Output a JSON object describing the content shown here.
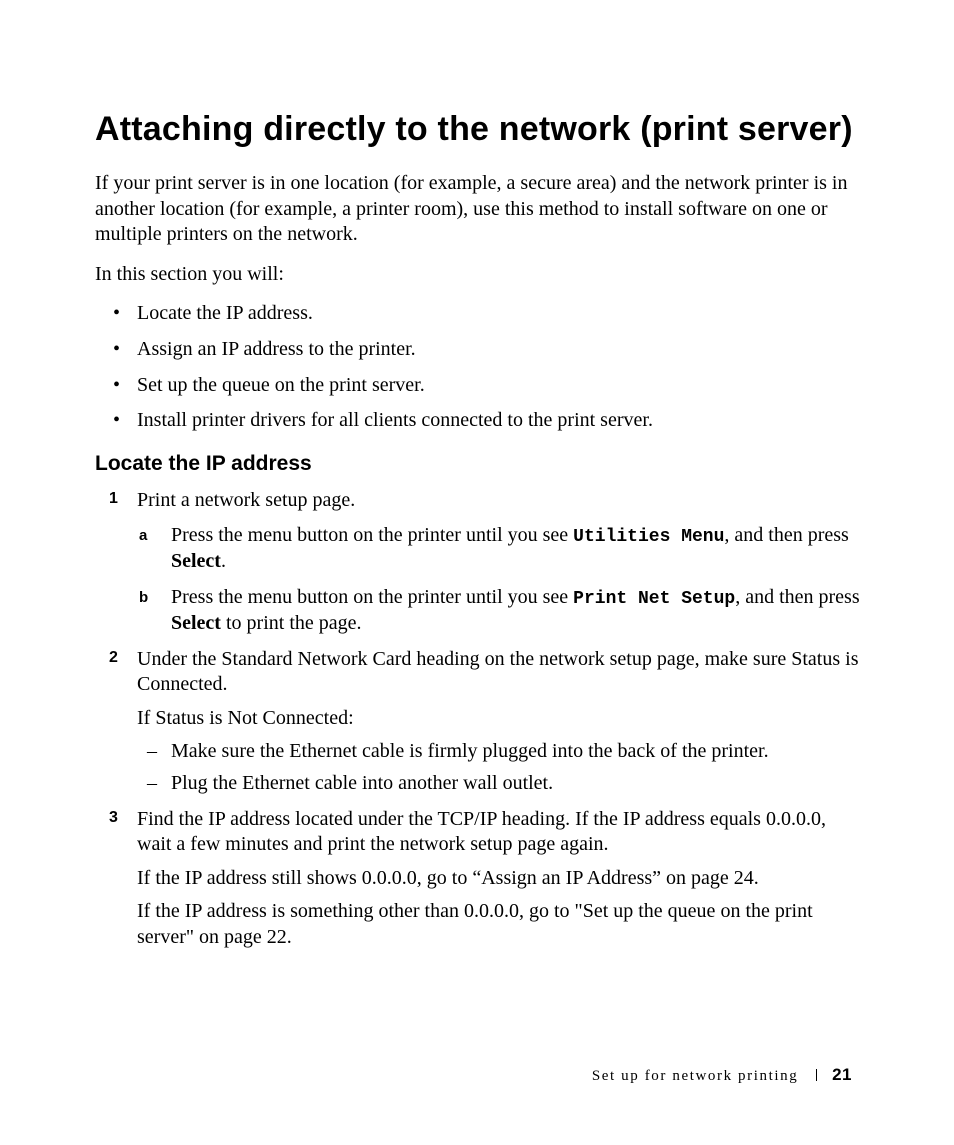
{
  "title": "Attaching directly to the network (print server)",
  "intro": "If your print server is in one location (for example, a secure area) and the network printer is in another location (for example, a printer room), use this method to install software on one or multiple printers on the network.",
  "lead_in": "In this section you will:",
  "bullets": [
    "Locate the IP address.",
    "Assign an IP address to the printer.",
    "Set up the queue on the print server.",
    "Install printer drivers for all clients connected to the print server."
  ],
  "subhead": "Locate the IP address",
  "step1": {
    "num": "1",
    "text": "Print a network setup page.",
    "a": {
      "label": "a",
      "pre": "Press the menu button on the printer until you see ",
      "code": "Utilities Menu",
      "post1": ", and then press ",
      "bold": "Select",
      "post2": "."
    },
    "b": {
      "label": "b",
      "pre": "Press the menu button on the printer until you see ",
      "code": "Print Net Setup",
      "post1": ", and then press ",
      "bold": "Select",
      "post2": " to print the page."
    }
  },
  "step2": {
    "num": "2",
    "text": "Under the Standard Network Card heading on the network setup page, make sure Status is Connected.",
    "note": "If Status is Not Connected:",
    "dashes": [
      "Make sure the Ethernet cable is firmly plugged into the back of the printer.",
      "Plug the Ethernet cable into another wall outlet."
    ]
  },
  "step3": {
    "num": "3",
    "text": "Find the IP address located under the TCP/IP heading. If the IP address equals 0.0.0.0, wait a few minutes and print the network setup page again.",
    "p2": "If the IP address still shows 0.0.0.0, go to “Assign an IP Address” on page 24.",
    "p3": "If the IP address is something other than 0.0.0.0, go to \"Set up the queue on the print server\" on page 22."
  },
  "footer": {
    "section": "Set up for network printing",
    "page": "21"
  }
}
